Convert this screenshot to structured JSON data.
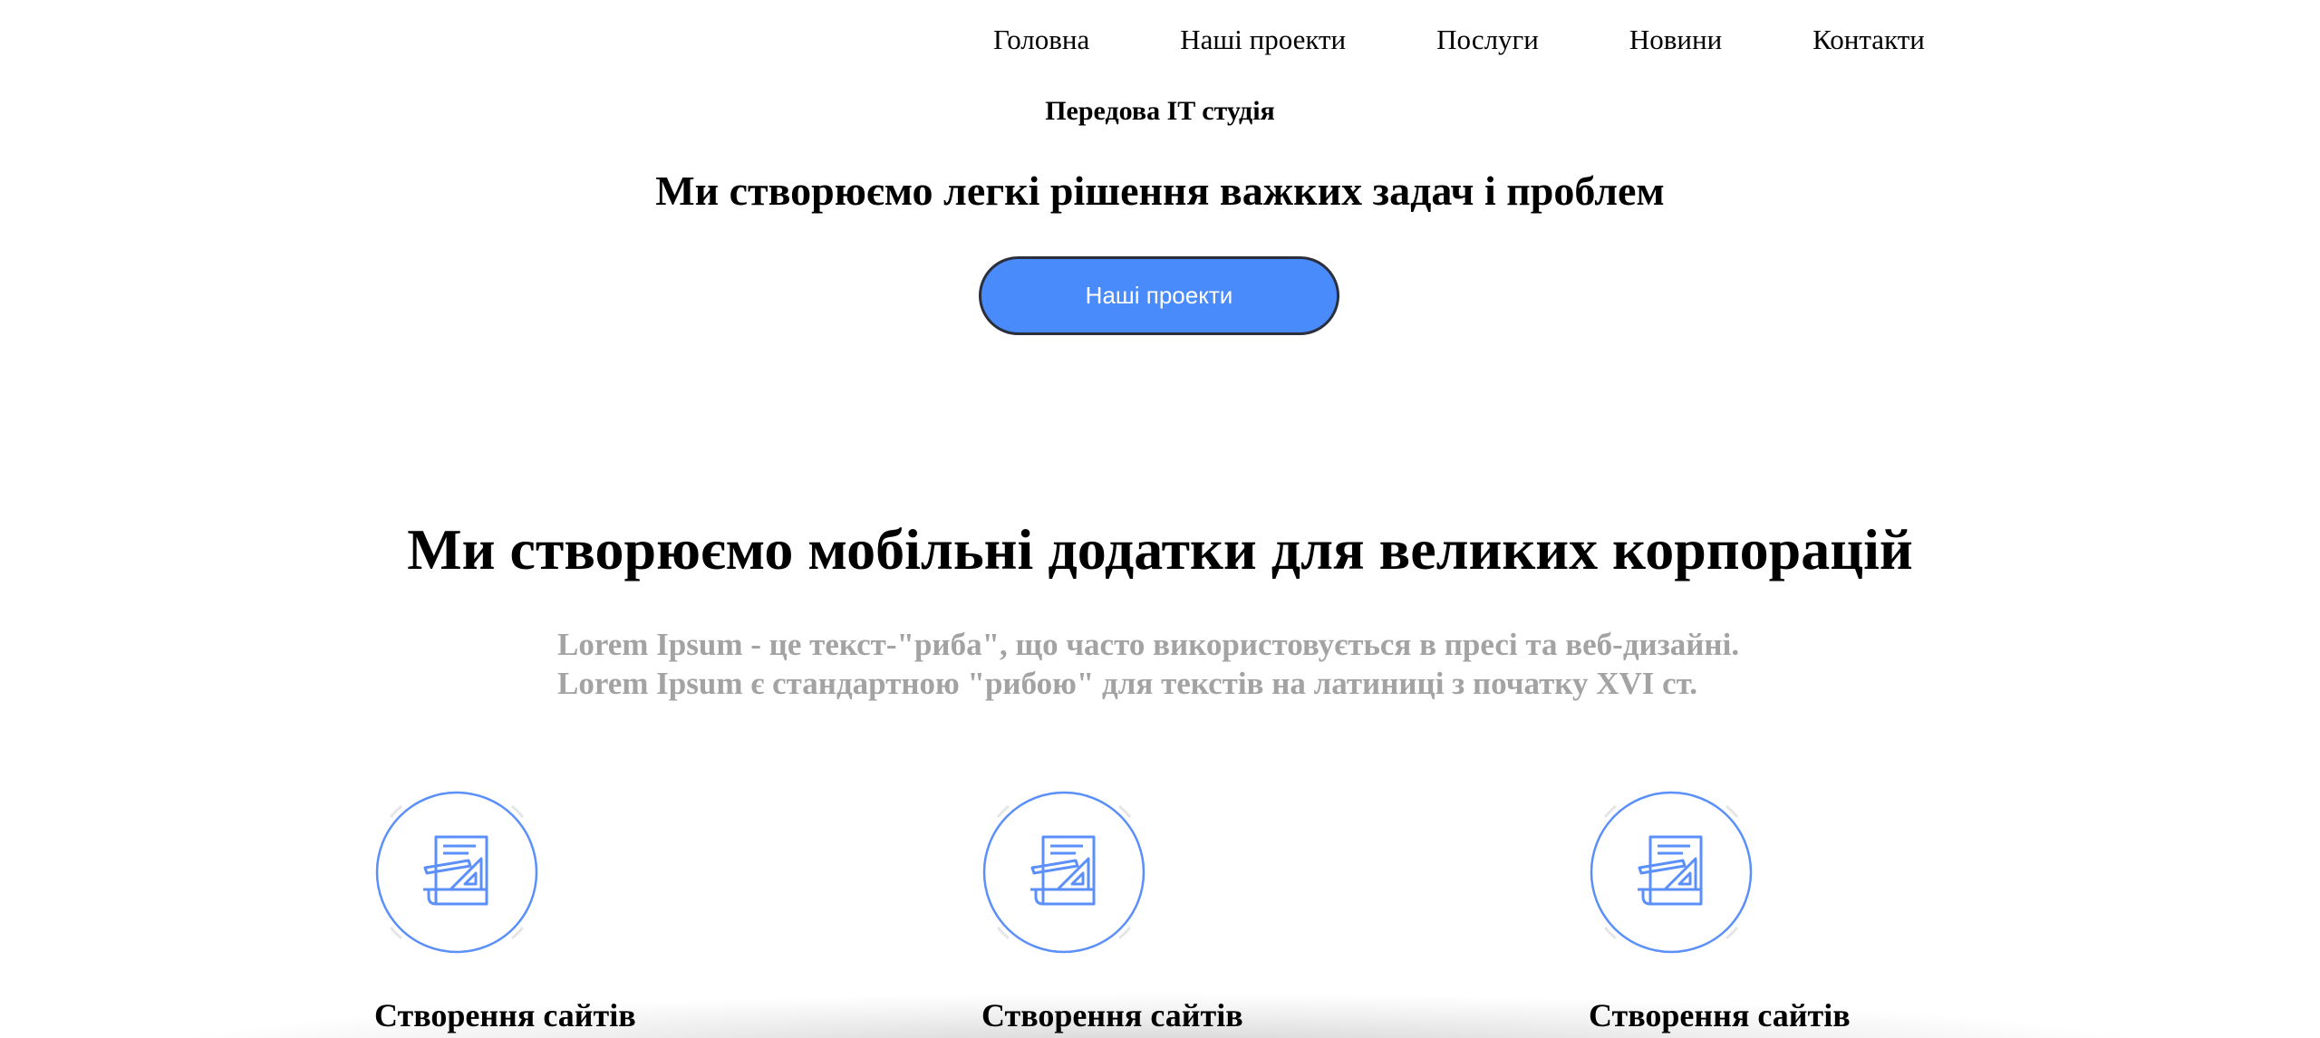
{
  "nav": {
    "items": [
      {
        "label": "Головна"
      },
      {
        "label": "Наші проекти"
      },
      {
        "label": "Послуги"
      },
      {
        "label": "Новини"
      },
      {
        "label": "Контакти"
      }
    ]
  },
  "hero": {
    "tagline": "Передова IT студія",
    "title": "Ми створюємо легкі рішення важких задач і проблем",
    "button_label": "Наші проекти"
  },
  "section": {
    "title": "Ми створюємо мобільні додатки для великих корпорацій",
    "description_lines": [
      "Lorem Ipsum - це текст-\"риба\", що часто використовується в пресі та веб-дизайні.",
      "Lorem Ipsum є стандартною \"рибою\" для текстів на латиниці з початку XVI ст."
    ]
  },
  "services": [
    {
      "title": "Створення сайтів",
      "icon": "blueprint-document-icon"
    },
    {
      "title": "Створення сайтів",
      "icon": "blueprint-document-icon"
    },
    {
      "title": "Створення сайтів",
      "icon": "blueprint-document-icon"
    }
  ],
  "colors": {
    "accent": "#4a8bfb",
    "icon_stroke": "#5b8ff9",
    "muted_text": "#a3a3a3",
    "button_border": "#2b2f3c"
  }
}
